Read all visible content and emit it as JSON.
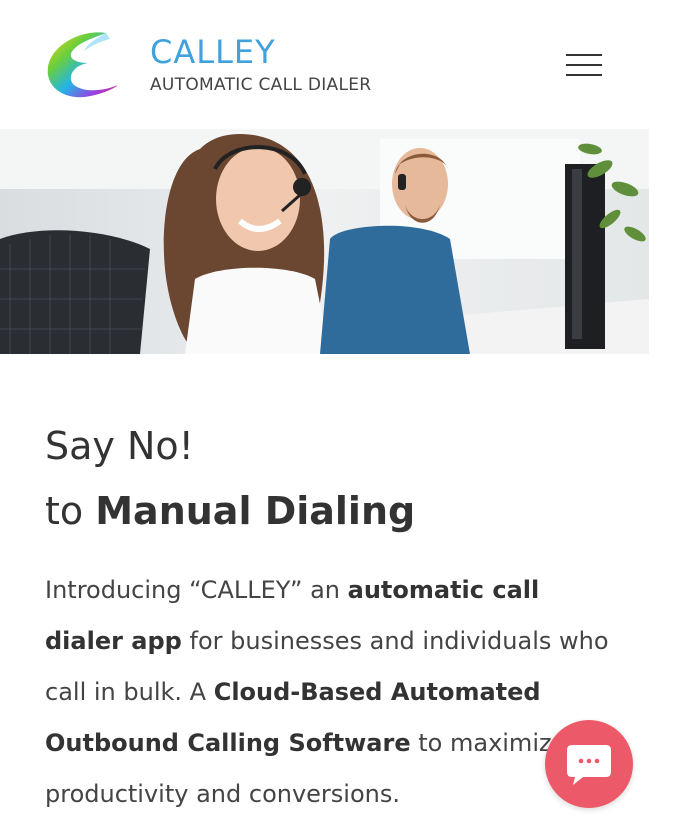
{
  "header": {
    "brand_name": "CALLEY",
    "brand_tagline": "AUTOMATIC CALL DIALER",
    "menu_icon": "hamburger-menu-icon",
    "brand_color": "#3fa2dc"
  },
  "hero": {
    "image": "call-center-agents-photo"
  },
  "main": {
    "headline_line1": "Say No!",
    "headline_line2_prefix": "to ",
    "headline_line2_bold": "Manual Dialing",
    "intro": [
      {
        "text": "Introducing “CALLEY” an ",
        "bold": false
      },
      {
        "text": "automatic call dialer app",
        "bold": true
      },
      {
        "text": " for businesses and individuals who call in bulk. A ",
        "bold": false
      },
      {
        "text": "Cloud-Based Automated Outbound Calling Software",
        "bold": true
      },
      {
        "text": " to maximize productivity and conversions.",
        "bold": false
      }
    ]
  },
  "chat": {
    "icon": "chat-bubble-icon",
    "color": "#ec5a6a"
  }
}
